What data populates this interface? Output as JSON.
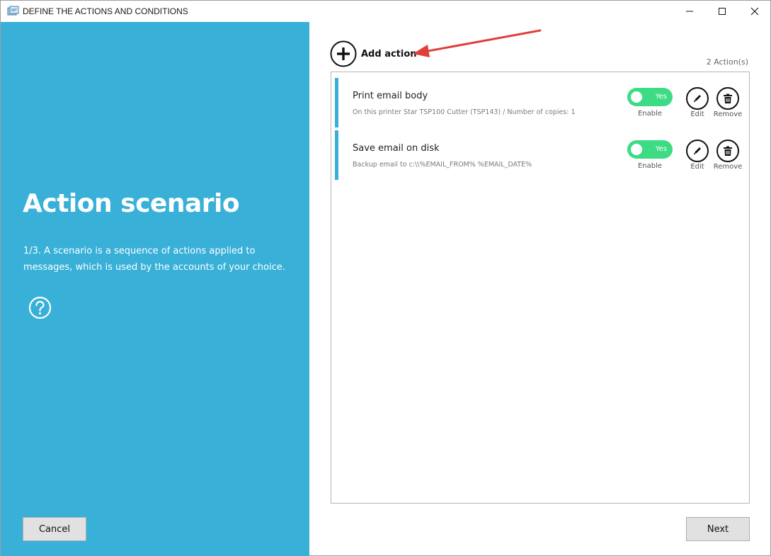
{
  "window": {
    "title": "DEFINE THE ACTIONS AND CONDITIONS",
    "icon": "app-wizard-icon"
  },
  "left": {
    "title": "Action scenario",
    "description": "1/3. A scenario is a sequence of actions applied to messages, which is used by the accounts of your choice.",
    "cancel_label": "Cancel",
    "background_color": "#38b0d7"
  },
  "main": {
    "add_action_label": "Add action",
    "action_count_label": "2  Action(s)",
    "next_label": "Next",
    "actions": [
      {
        "title": "Print email body",
        "subtitle": "On this printer Star TSP100 Cutter (TSP143) / Number of copies: 1",
        "toggle_text": "Yes",
        "enable_label": "Enable",
        "edit_label": "Edit",
        "remove_label": "Remove"
      },
      {
        "title": "Save email on disk",
        "subtitle": "Backup email to c:\\\\%EMAIL_FROM% %EMAIL_DATE%",
        "toggle_text": "Yes",
        "enable_label": "Enable",
        "edit_label": "Edit",
        "remove_label": "Remove"
      }
    ],
    "toggle_color": "#3ddc84",
    "accent_color": "#38b0d7",
    "annotation_arrow_color": "#e0403a"
  }
}
